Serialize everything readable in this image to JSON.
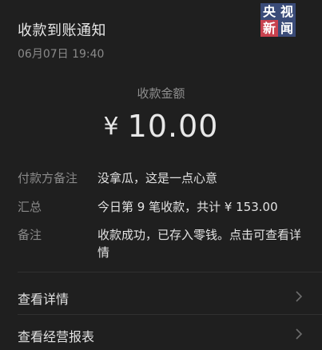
{
  "header": {
    "title": "收款到账通知",
    "datetime": "06月07日 19:40"
  },
  "badge": {
    "chars": [
      "央",
      "视",
      "新",
      "闻"
    ],
    "colors": [
      "#3a4b78",
      "#3a4b78",
      "#c8414e",
      "#3a4b78"
    ]
  },
  "amount": {
    "label": "收款金额",
    "currency": "¥",
    "value": "10.00"
  },
  "details": [
    {
      "key": "付款方备注",
      "value": "没拿瓜，这是一点心意"
    },
    {
      "key": "汇总",
      "value": "今日第 9 笔收款，共计 ¥ 153.00"
    },
    {
      "key": "备注",
      "value": "收款成功，已存入零钱。点击可查看详情"
    }
  ],
  "links": [
    {
      "label": "查看详情",
      "icon": "chevron-right-icon"
    },
    {
      "label": "查看经营报表",
      "icon": "chevron-right-icon"
    }
  ],
  "colors": {
    "background": "#1f1f1f",
    "primary_text": "#e2e2e2",
    "secondary_text": "#8a8a8a"
  }
}
